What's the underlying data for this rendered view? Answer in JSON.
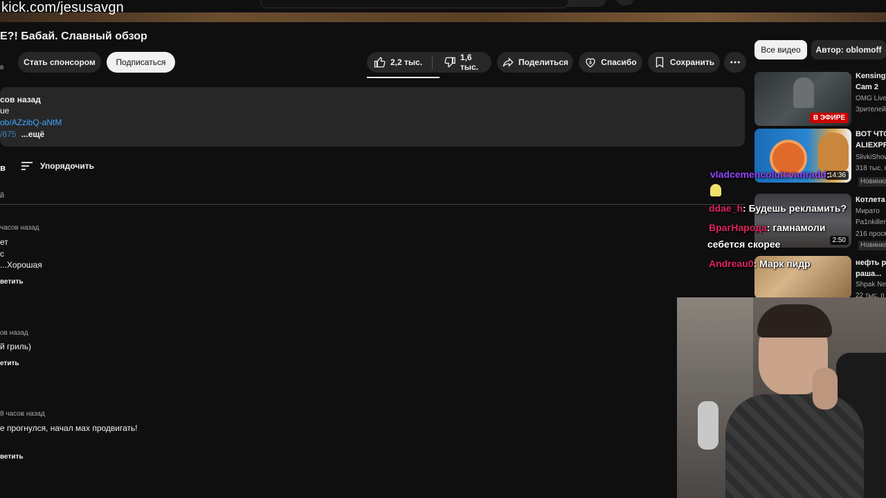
{
  "overlay": {
    "stream_url": "kick.com/jesusavgn"
  },
  "video": {
    "title": "E?! Бабай. Славный обзор",
    "sub_count": "в",
    "sponsor_label": "Стать спонсором",
    "subscribe_label": "Подписаться",
    "likes": "2,2 тыс.",
    "dislikes": "1,6 тыс.",
    "share_label": "Поделиться",
    "thanks_label": "Спасибо",
    "save_label": "Сохранить",
    "more_icon": "more-horizontal-icon"
  },
  "description": {
    "line1": "сов назад",
    "line2": "ue",
    "link": "ob/AZzibQ-aNtM",
    "line4_num": "/875⁠",
    "more_label": "...ещё"
  },
  "comments": {
    "count": "в",
    "sort_label": "Упорядочить",
    "add_placeholder": "й",
    "items": [
      {
        "meta": "часов назад",
        "lines": [
          "ет",
          "с",
          "...Хорошая"
        ],
        "reply": "ветить"
      },
      {
        "meta": "ов назад",
        "lines": [
          "й гриль)"
        ],
        "reply": "етить"
      },
      {
        "meta": "8 часов назад",
        "lines": [
          "е прогнулся, начал мах продвигать!"
        ],
        "reply": "ветить"
      }
    ]
  },
  "sidebar": {
    "chip_all": "Все видео",
    "chip_author": "Автор: oblomoff",
    "videos": [
      {
        "title1": "Kensingt",
        "title2": "Cam 2",
        "channel": "OMG Live",
        "stats": "Зрителей",
        "badge": "В ЭФИРЕ"
      },
      {
        "title1": "ВОТ ЧТО",
        "title2": "ALIEXPR",
        "channel": "SlivkiShow",
        "stats": "318 тыс. п",
        "badge": "14:36",
        "extra": "Новинка"
      },
      {
        "title1": "Котлета",
        "title2": "Мирато",
        "channel": "Pa1nkiller",
        "stats": "216 просм",
        "badge": "2:50",
        "extra": "Новинка"
      },
      {
        "title1": "нефть р",
        "title2": "раша...",
        "channel": "Shpak New",
        "stats": "22 тыс. п"
      }
    ]
  },
  "chat": [
    {
      "user": "vladcemencolutsvanradd",
      "text": ":",
      "color": "#9147ff"
    },
    {
      "user": "ddae_h",
      "text": ": Будешь рекламить?",
      "color": "#e0245e"
    },
    {
      "user": "ВрагНарода",
      "text": ": гамнамоли",
      "text2": "себется скорее",
      "color": "#e0245e"
    },
    {
      "user": "Andreau0",
      "text": ": Марк пидр",
      "color": "#e0245e"
    }
  ]
}
